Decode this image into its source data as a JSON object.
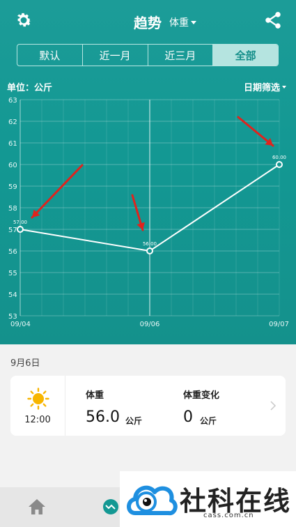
{
  "header": {
    "title": "趋势",
    "metric": "体重"
  },
  "range_tabs": [
    {
      "label": "默认",
      "active": false
    },
    {
      "label": "近一月",
      "active": false
    },
    {
      "label": "近三月",
      "active": false
    },
    {
      "label": "全部",
      "active": true
    }
  ],
  "unit_label": "单位：公斤",
  "date_filter_label": "日期筛选",
  "chart_data": {
    "type": "line",
    "categories": [
      "09/04",
      "09/06",
      "09/07"
    ],
    "series": [
      {
        "values": [
          57.0,
          56.0,
          60.0
        ],
        "labels": [
          "57.00",
          "56.00",
          "60.00"
        ]
      }
    ],
    "xlabel": "",
    "ylabel": "",
    "ylim": [
      53,
      63
    ],
    "yticks": [
      53,
      54,
      55,
      56,
      57,
      58,
      59,
      60,
      61,
      62,
      63
    ],
    "grid": true,
    "highlighted_category": "09/06"
  },
  "detail": {
    "date": "9月6日",
    "time": "12:00",
    "weight_label": "体重",
    "weight_value": "56.0",
    "weight_unit": "公斤",
    "change_label": "体重变化",
    "change_value": "0",
    "change_unit": "公斤"
  },
  "watermark": {
    "text": "社科在线",
    "url": "cass.com.cn"
  },
  "colors": {
    "teal": "#139893",
    "arrow_red": "#e0231d",
    "sun_yellow": "#f7b500"
  }
}
